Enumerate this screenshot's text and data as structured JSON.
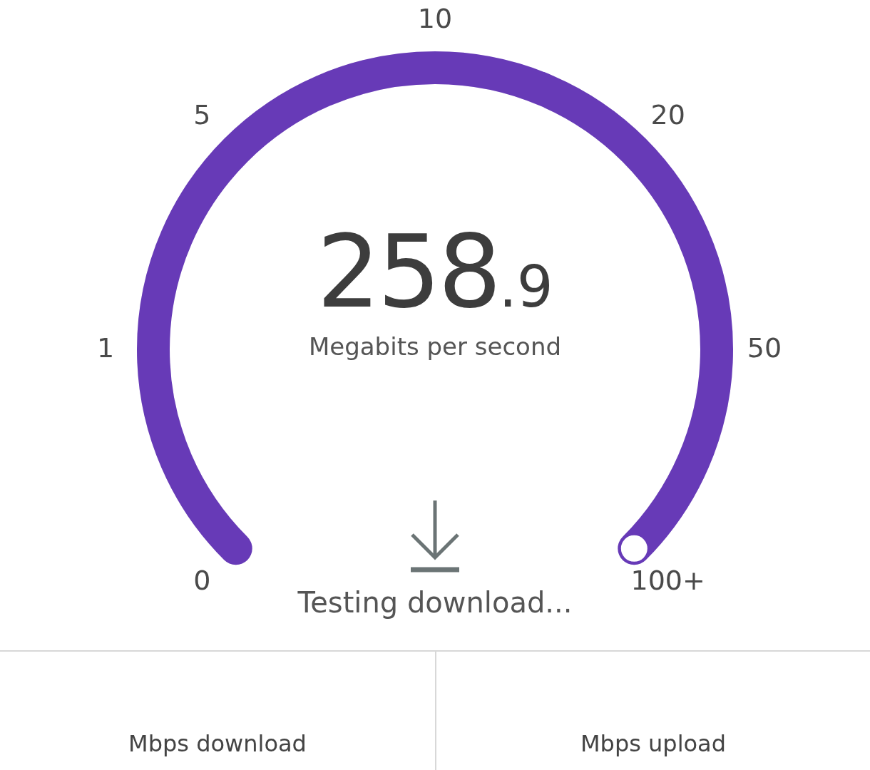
{
  "gauge": {
    "ticks": [
      "0",
      "1",
      "5",
      "10",
      "20",
      "50",
      "100+"
    ],
    "level": 1,
    "value_integer": "258",
    "value_decimal": ".9",
    "unit": "Megabits per second",
    "status": "Testing download..."
  },
  "results": [
    {
      "label": "Mbps download"
    },
    {
      "label": "Mbps upload"
    }
  ]
}
